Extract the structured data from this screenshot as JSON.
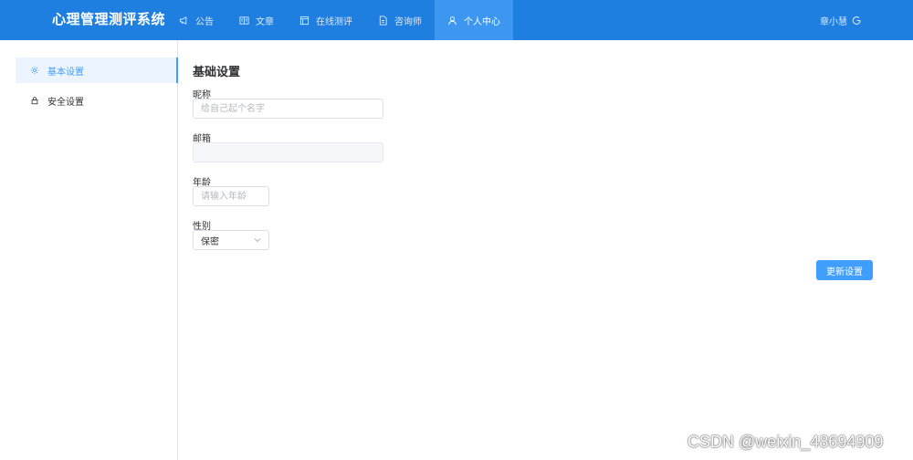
{
  "app": {
    "title": "心理管理测评系统"
  },
  "nav": {
    "items": [
      {
        "label": "公告",
        "icon": "megaphone-icon"
      },
      {
        "label": "文章",
        "icon": "book-icon"
      },
      {
        "label": "在线测评",
        "icon": "clipboard-icon"
      },
      {
        "label": "咨询师",
        "icon": "document-icon"
      },
      {
        "label": "个人中心",
        "icon": "user-icon",
        "active": true
      }
    ]
  },
  "user": {
    "name": "章小慧",
    "logout_icon": "power-icon"
  },
  "sidebar": {
    "items": [
      {
        "label": "基本设置",
        "icon": "gear-icon",
        "active": true
      },
      {
        "label": "安全设置",
        "icon": "lock-icon"
      }
    ]
  },
  "form": {
    "title": "基础设置",
    "nickname": {
      "label": "昵称",
      "value": "",
      "placeholder": "给自己起个名字"
    },
    "email": {
      "label": "邮箱",
      "value": "",
      "disabled": true
    },
    "age": {
      "label": "年龄",
      "value": "",
      "placeholder": "请输入年龄"
    },
    "gender": {
      "label": "性别",
      "value": "保密"
    },
    "submit_label": "更新设置"
  },
  "watermark": "CSDN @weixin_48694909",
  "colors": {
    "header": "#1e7fe0",
    "nav_active": "#3d97f1",
    "primary": "#409eff",
    "sidebar_active_bg": "#ecf5ff"
  }
}
